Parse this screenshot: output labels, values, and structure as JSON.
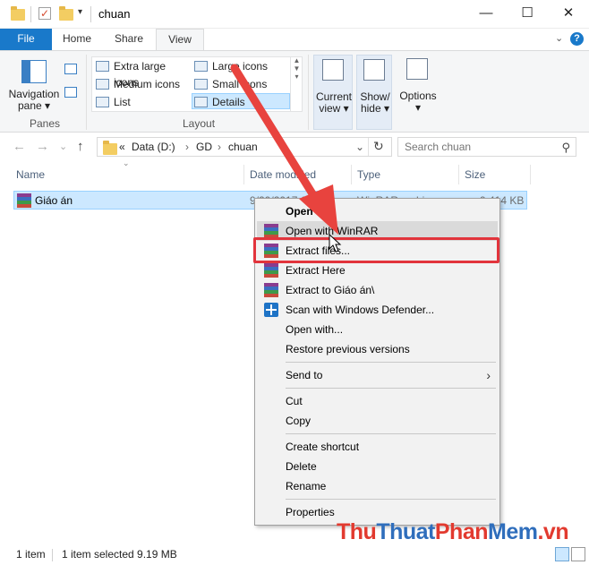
{
  "window": {
    "title": "chuan",
    "minimize_glyph": "—",
    "maximize_glyph": "☐",
    "close_glyph": "✕",
    "qat_dropdown": "▾"
  },
  "tabs": {
    "file": "File",
    "home": "Home",
    "share": "Share",
    "view": "View",
    "collapse_glyph": "⌄",
    "help_glyph": "?"
  },
  "ribbon": {
    "panes": {
      "navigation_pane": "Navigation",
      "navigation_pane_2": "pane ▾",
      "group_label": "Panes"
    },
    "layout": {
      "group_label": "Layout",
      "items": [
        "Extra large icons",
        "Large icons",
        "Medium icons",
        "Small icons",
        "List",
        "Details"
      ],
      "selected": "Details"
    },
    "current_view": {
      "line1": "Current",
      "line2": "view ▾"
    },
    "show_hide": {
      "line1": "Show/",
      "line2": "hide ▾"
    },
    "options": {
      "label": "Options",
      "arrow": "▾"
    }
  },
  "address": {
    "back": "←",
    "forward": "→",
    "recent": "⌄",
    "up": "↑",
    "overflow": "«",
    "crumbs": [
      "Data (D:)",
      "GD",
      "chuan"
    ],
    "crumb_sep": "›",
    "dropdown_glyph": "⌄",
    "refresh_glyph": "↻",
    "search_placeholder": "Search chuan",
    "search_glyph": "⚲"
  },
  "columns": {
    "sort_glyph": "⌄",
    "name": "Name",
    "date_modified": "Date modified",
    "type": "Type",
    "size": "Size"
  },
  "file": {
    "name": "Giáo án",
    "date": "9/20/2017 1:44",
    "type": "WinRAR archive",
    "size": "9,414 KB"
  },
  "context_menu": {
    "open": "Open",
    "open_with_winrar": "Open with WinRAR",
    "extract_files": "Extract files...",
    "extract_here": "Extract Here",
    "extract_to": "Extract to Giáo án\\",
    "scan_defender": "Scan with Windows Defender...",
    "open_with": "Open with...",
    "restore_versions": "Restore previous versions",
    "send_to": "Send to",
    "submenu_glyph": "›",
    "cut": "Cut",
    "copy": "Copy",
    "create_shortcut": "Create shortcut",
    "delete": "Delete",
    "rename": "Rename",
    "properties": "Properties"
  },
  "status": {
    "count": "1 item",
    "selected": "1 item selected  9.19 MB"
  },
  "watermark": {
    "part1": "Thu",
    "part2": "Thuat",
    "part3": "Phan",
    "part4": "Mem",
    "part5": ".vn"
  },
  "colors": {
    "accent": "#1979ca",
    "selection": "#cce8ff",
    "highlight_box": "#e2343c",
    "arrow": "#e8433e"
  }
}
